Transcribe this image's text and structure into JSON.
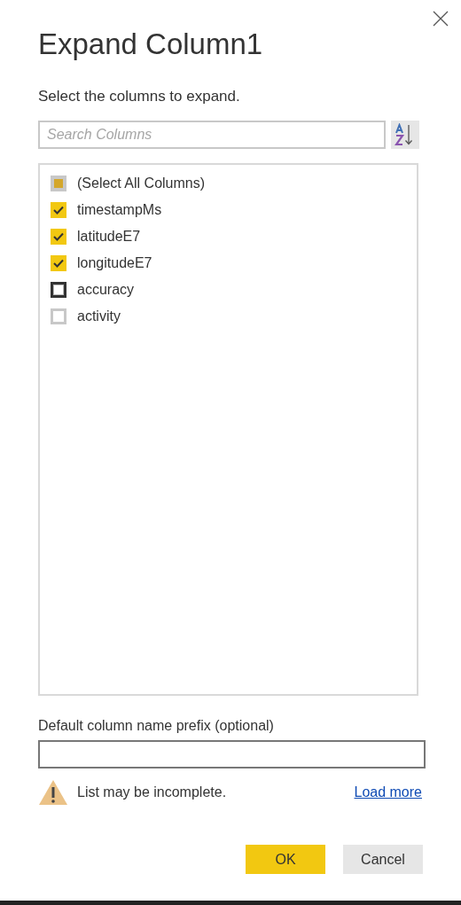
{
  "dialog": {
    "title": "Expand Column1",
    "subtitle": "Select the columns to expand.",
    "search": {
      "placeholder": "Search Columns"
    },
    "columns": [
      {
        "label": "(Select All Columns)",
        "checked": false,
        "indeterminate": true,
        "focused": false
      },
      {
        "label": "timestampMs",
        "checked": true,
        "indeterminate": false,
        "focused": false
      },
      {
        "label": "latitudeE7",
        "checked": true,
        "indeterminate": false,
        "focused": false
      },
      {
        "label": "longitudeE7",
        "checked": true,
        "indeterminate": false,
        "focused": false
      },
      {
        "label": "accuracy",
        "checked": false,
        "indeterminate": false,
        "focused": true
      },
      {
        "label": "activity",
        "checked": false,
        "indeterminate": false,
        "focused": false
      }
    ],
    "prefix": {
      "label": "Default column name prefix (optional)"
    },
    "warning": {
      "text": "List may be incomplete.",
      "link": "Load more"
    },
    "buttons": [
      {
        "label": "OK",
        "kind": "primary"
      },
      {
        "label": "Cancel",
        "kind": "secondary"
      }
    ]
  }
}
